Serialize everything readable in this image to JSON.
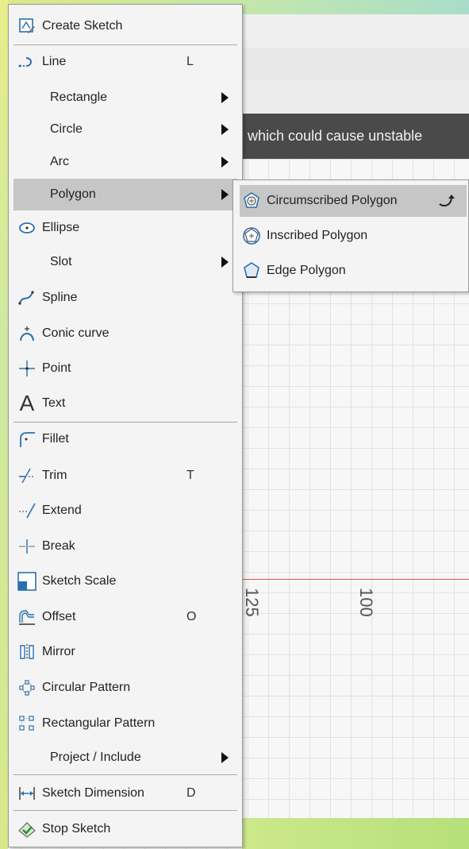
{
  "background": {
    "warning_text": "which could cause unstable",
    "ruler_labels": [
      "125",
      "100"
    ]
  },
  "menu": {
    "create_sketch": "Create Sketch",
    "line": {
      "label": "Line",
      "shortcut": "L"
    },
    "rectangle": "Rectangle",
    "circle": "Circle",
    "arc": "Arc",
    "polygon": "Polygon",
    "ellipse": "Ellipse",
    "slot": "Slot",
    "spline": "Spline",
    "conic_curve": "Conic curve",
    "point": "Point",
    "text": "Text",
    "fillet": "Fillet",
    "trim": {
      "label": "Trim",
      "shortcut": "T"
    },
    "extend": "Extend",
    "break": "Break",
    "sketch_scale": "Sketch Scale",
    "offset": {
      "label": "Offset",
      "shortcut": "O"
    },
    "mirror": "Mirror",
    "circular_pattern": "Circular Pattern",
    "rectangular_pattern": "Rectangular Pattern",
    "project_include": "Project / Include",
    "sketch_dimension": {
      "label": "Sketch Dimension",
      "shortcut": "D"
    },
    "stop_sketch": "Stop Sketch"
  },
  "submenu": {
    "circumscribed_polygon": "Circumscribed Polygon",
    "inscribed_polygon": "Inscribed Polygon",
    "edge_polygon": "Edge Polygon"
  },
  "colors": {
    "highlight": "#c6c6c6",
    "sketch_axis": "#e05050",
    "icon_blue": "#2a6fb0"
  }
}
